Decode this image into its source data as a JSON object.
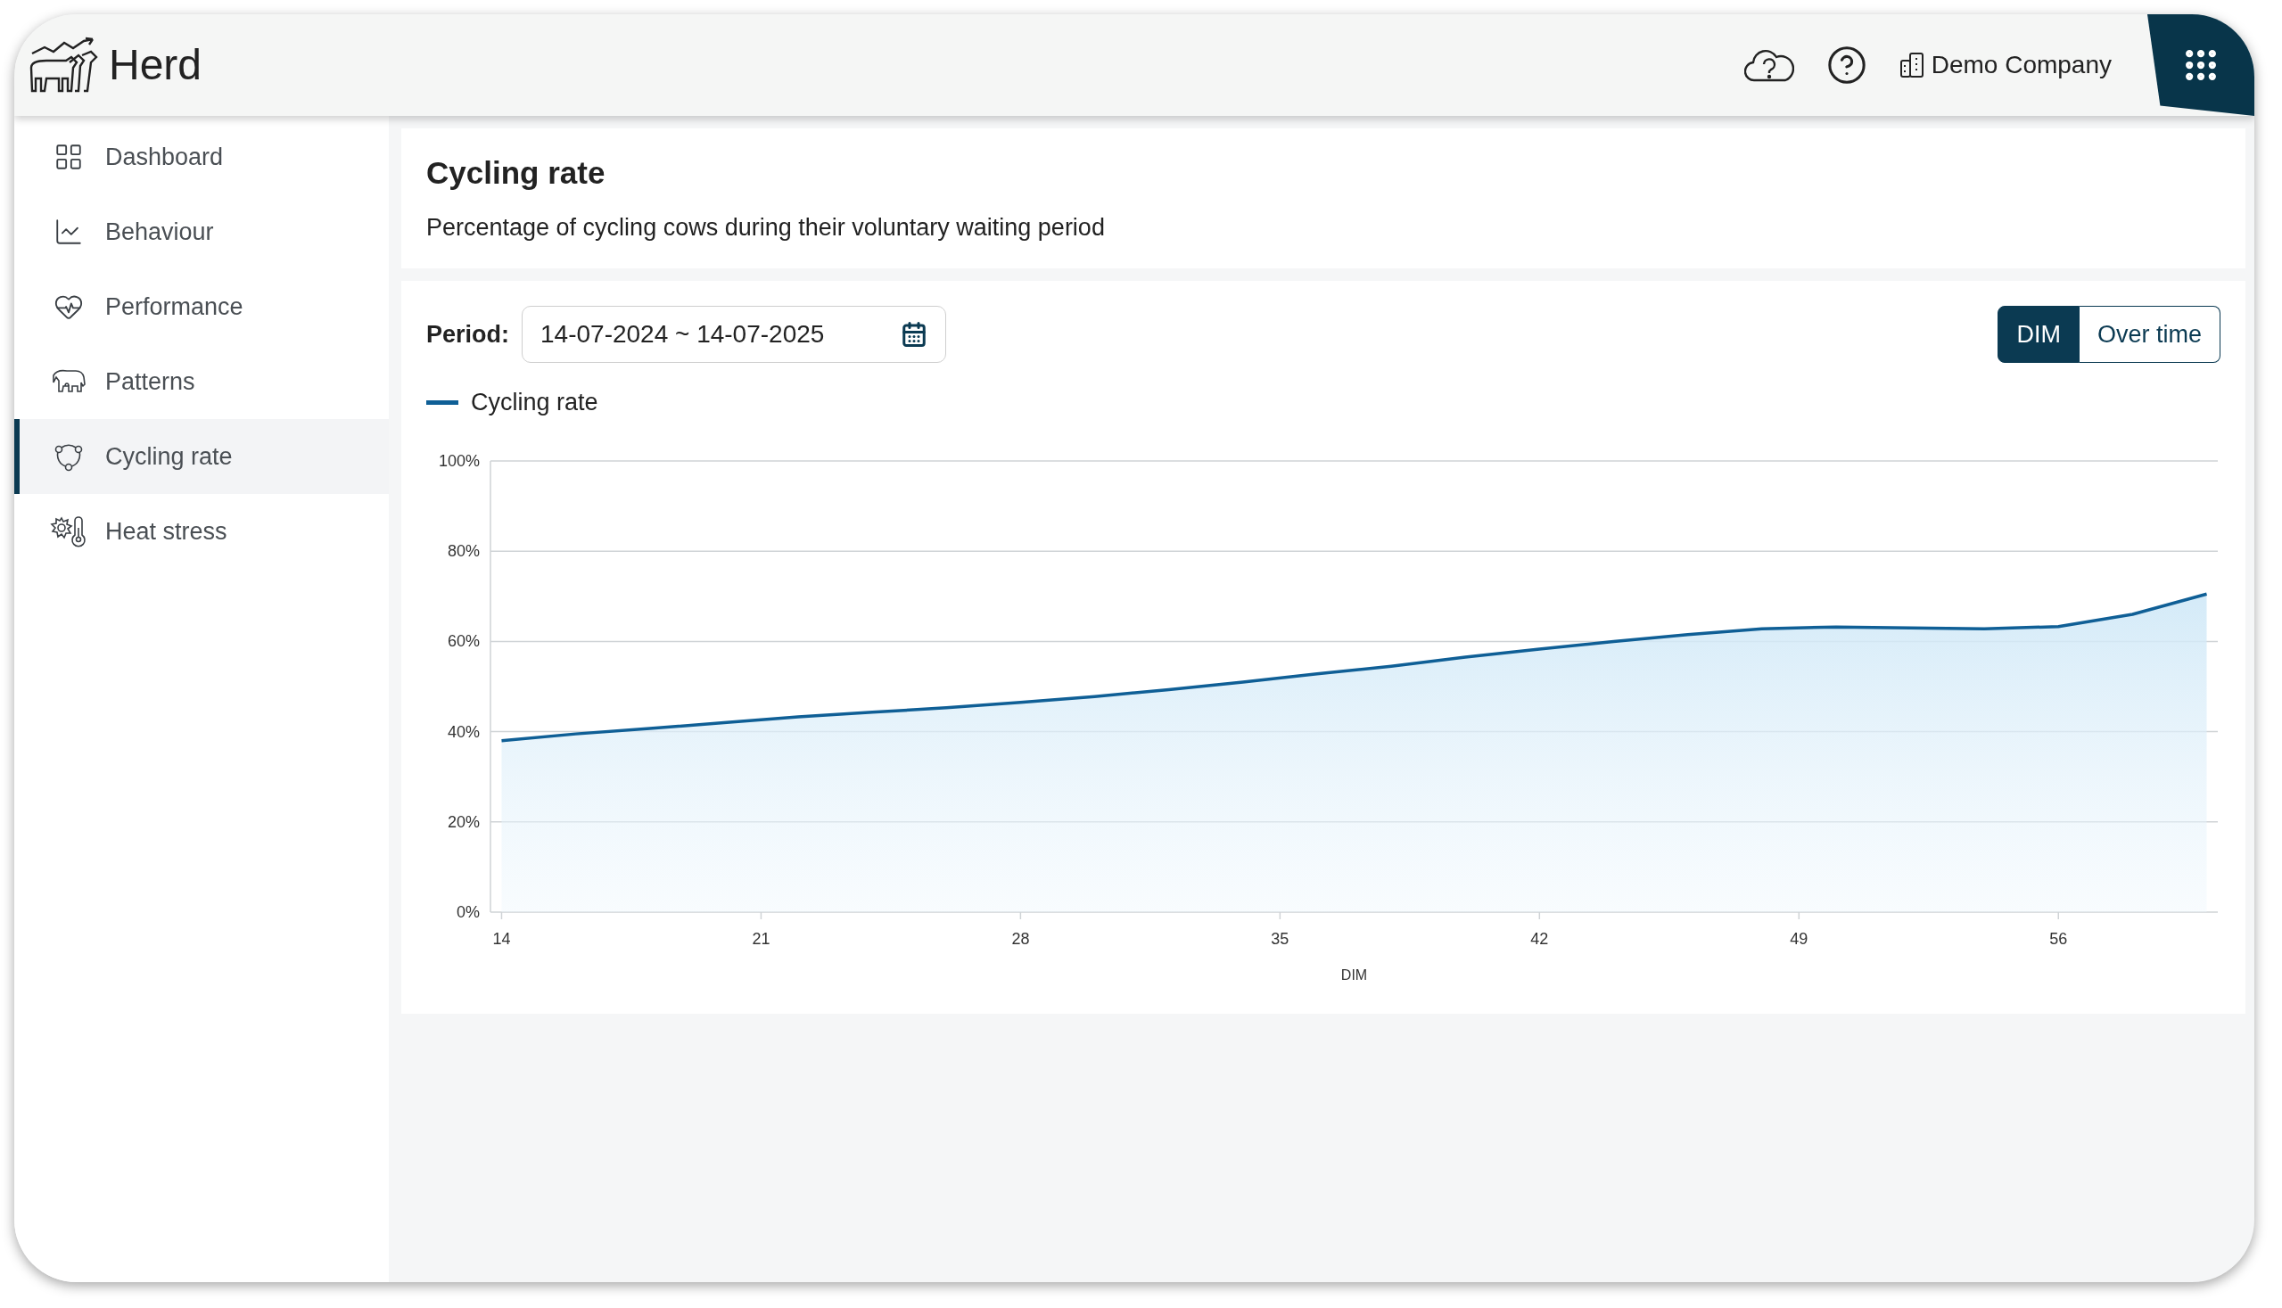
{
  "app": {
    "title": "Herd"
  },
  "header": {
    "company": "Demo Company"
  },
  "sidebar": {
    "items": [
      {
        "label": "Dashboard",
        "kind": "dashboard",
        "selected": false
      },
      {
        "label": "Behaviour",
        "kind": "behaviour",
        "selected": false
      },
      {
        "label": "Performance",
        "kind": "performance",
        "selected": false
      },
      {
        "label": "Patterns",
        "kind": "patterns",
        "selected": false
      },
      {
        "label": "Cycling rate",
        "kind": "cycling",
        "selected": true
      },
      {
        "label": "Heat stress",
        "kind": "heat",
        "selected": false
      }
    ]
  },
  "page": {
    "title": "Cycling rate",
    "subtitle": "Percentage of cycling cows during their voluntary waiting period"
  },
  "filters": {
    "period_label": "Period:",
    "period_value": "14-07-2024 ~ 14-07-2025"
  },
  "view_toggle": [
    {
      "label": "DIM",
      "selected": true
    },
    {
      "label": "Over time",
      "selected": false
    }
  ],
  "chart": {
    "chart_data": {
      "type": "area",
      "xlabel": "DIM",
      "x": [
        14,
        16,
        18,
        20,
        22,
        24,
        26,
        28,
        30,
        32,
        34,
        36,
        38,
        40,
        42,
        44,
        46,
        48,
        50,
        52,
        54,
        56,
        58,
        60
      ],
      "series": [
        {
          "name": "Cycling rate",
          "color": "#0f5f96",
          "values": [
            38,
            39.5,
            40.7,
            42,
            43.3,
            44.3,
            45.3,
            46.5,
            47.8,
            49.3,
            51,
            52.8,
            54.5,
            56.5,
            58.3,
            60,
            61.5,
            62.8,
            63.2,
            63,
            62.8,
            63.3,
            66,
            70.5
          ]
        }
      ],
      "xlim": [
        13.7,
        60.3
      ],
      "grid": true,
      "ylim": [
        0,
        100
      ],
      "xticks": [
        14,
        21,
        28,
        35,
        42,
        49,
        56
      ],
      "yticks": [
        {
          "value": 0,
          "label": "0%"
        },
        {
          "value": 20,
          "label": "20%"
        },
        {
          "value": 40,
          "label": "40%"
        },
        {
          "value": 60,
          "label": "60%"
        },
        {
          "value": 80,
          "label": "80%"
        },
        {
          "value": 100,
          "label": "100%"
        }
      ]
    }
  }
}
